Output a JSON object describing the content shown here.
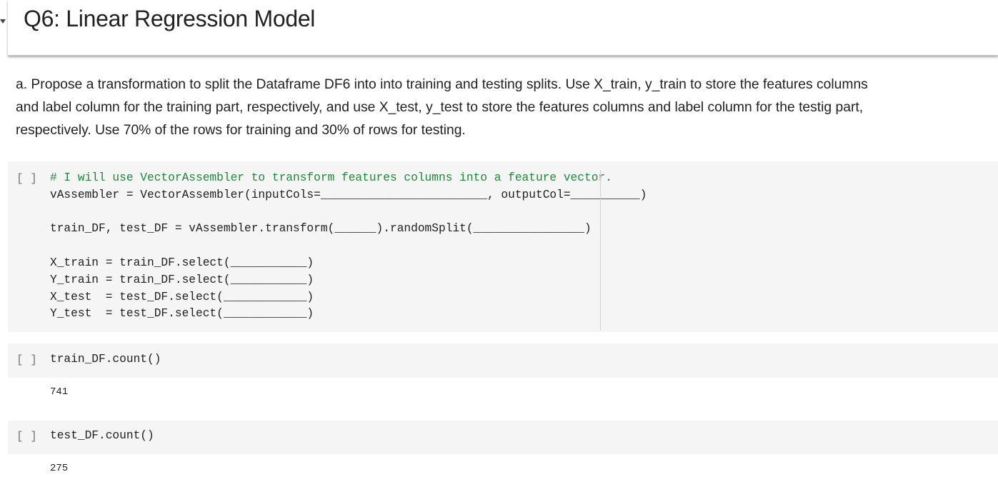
{
  "heading": {
    "title": "Q6: Linear Regression Model"
  },
  "text_cell": {
    "line1": "a. Propose a transformation to split the Dataframe DF6 into into training and testing splits. Use X_train, y_train to store the features columns",
    "line2": "and label column for the training part, respectively, and use X_test, y_test to store the features columns and label column for the testig part,",
    "line3": "respectively. Use 70% of the rows for training and 30% of rows for testing."
  },
  "cells": [
    {
      "run_indicator": "[ ]",
      "lines": [
        "# I will use VectorAssembler to transform features columns into a feature vector.",
        "vAssembler = VectorAssembler(inputCols=________________________, outputCol=__________)",
        "",
        "train_DF, test_DF = vAssembler.transform(______).randomSplit(________________)",
        "",
        "X_train = train_DF.select(___________)",
        "Y_train = train_DF.select(___________)",
        "X_test  = test_DF.select(____________)",
        "Y_test  = test_DF.select(____________)"
      ]
    },
    {
      "run_indicator": "[ ]",
      "lines": [
        "train_DF.count()"
      ],
      "output": "741"
    },
    {
      "run_indicator": "[ ]",
      "lines": [
        "test_DF.count()"
      ],
      "output": "275"
    }
  ],
  "colors": {
    "comment": "#22863a",
    "cell_background": "#f5f5f5"
  }
}
